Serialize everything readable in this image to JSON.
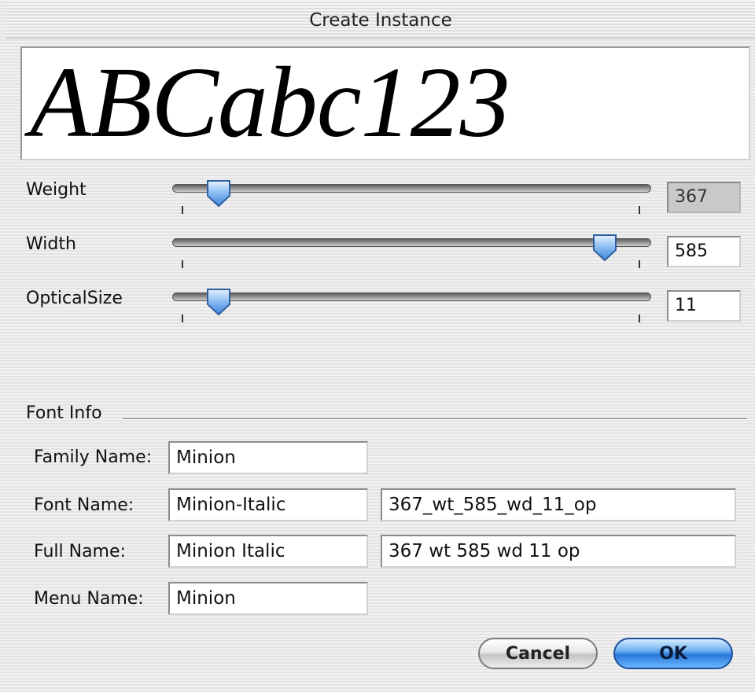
{
  "window": {
    "title": "Create Instance"
  },
  "preview": {
    "sample_text": "ABCabc123"
  },
  "axes": [
    {
      "label": "Weight",
      "value": "367",
      "slider_fraction": 0.08,
      "editable": false
    },
    {
      "label": "Width",
      "value": "585",
      "slider_fraction": 0.92,
      "editable": true
    },
    {
      "label": "OpticalSize",
      "value": "11",
      "slider_fraction": 0.08,
      "editable": true
    }
  ],
  "font_info": {
    "group_label": "Font Info",
    "family_name": {
      "label": "Family Name:",
      "value": "Minion"
    },
    "font_name": {
      "label": "Font Name:",
      "value": "Minion-Italic",
      "suffix": "367_wt_585_wd_11_op"
    },
    "full_name": {
      "label": "Full Name:",
      "value": "Minion Italic",
      "suffix": "367 wt 585 wd 11 op"
    },
    "menu_name": {
      "label": "Menu Name:",
      "value": "Minion"
    }
  },
  "buttons": {
    "cancel": "Cancel",
    "ok": "OK"
  },
  "colors": {
    "ok_button": "#2a78d8",
    "thumb": "#5d9ee8"
  },
  "icons": {
    "slider_thumb": "slider-thumb-icon"
  }
}
